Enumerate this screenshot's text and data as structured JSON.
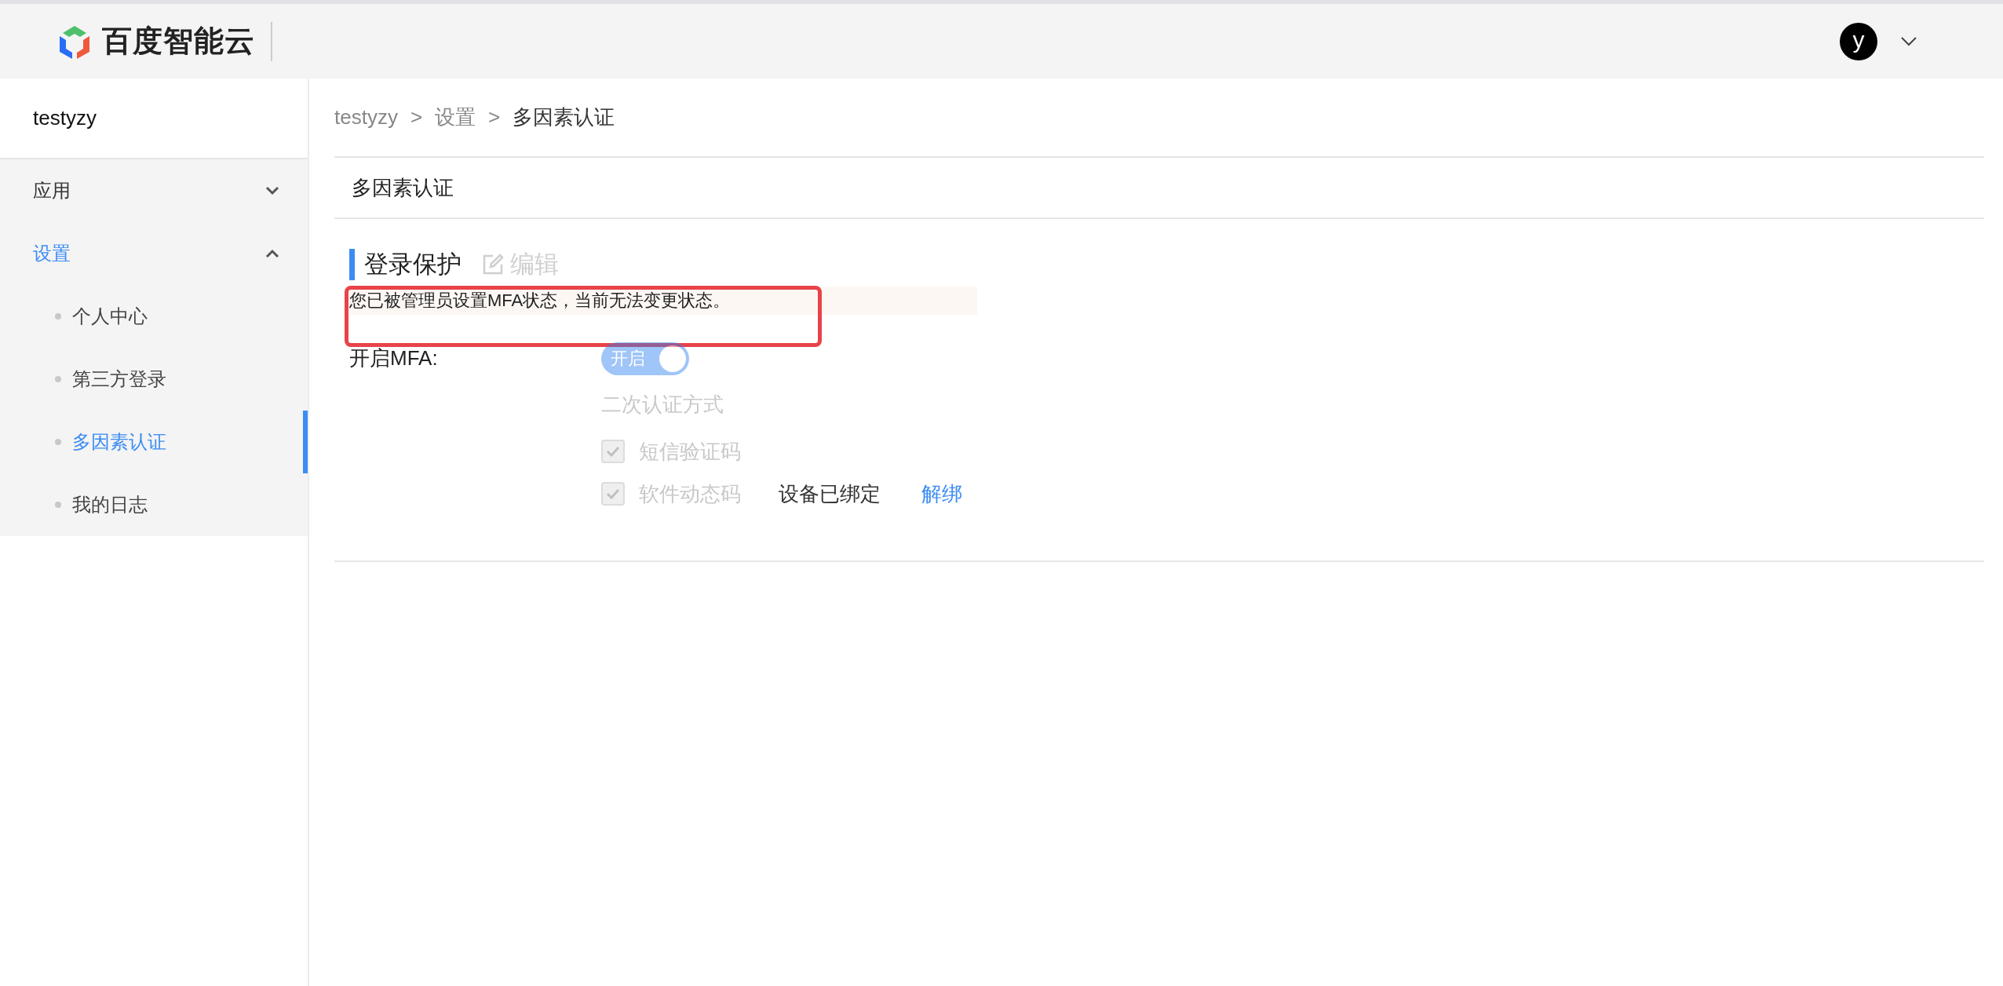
{
  "header": {
    "logo_text": "百度智能云",
    "avatar_letter": "y"
  },
  "sidebar": {
    "title": "testyzy",
    "items": [
      {
        "label": "应用",
        "expanded": false,
        "selected": false
      },
      {
        "label": "设置",
        "expanded": true,
        "selected": true,
        "children": [
          {
            "label": "个人中心",
            "selected": false
          },
          {
            "label": "第三方登录",
            "selected": false
          },
          {
            "label": "多因素认证",
            "selected": true
          },
          {
            "label": "我的日志",
            "selected": false
          }
        ]
      }
    ]
  },
  "breadcrumb": {
    "separator": ">",
    "items": [
      "testyzy",
      "设置",
      "多因素认证"
    ]
  },
  "page_title": "多因素认证",
  "section": {
    "title": "登录保护",
    "edit_label": "编辑",
    "edit_disabled": true,
    "notice": "您已被管理员设置MFA状态，当前无法变更状态。",
    "notice_highlighted": true
  },
  "mfa": {
    "label": "开启MFA:",
    "toggle": {
      "text": "开启",
      "on": true,
      "disabled": true
    },
    "methods_label": "二次认证方式",
    "methods": [
      {
        "label": "短信验证码",
        "checked": true,
        "disabled": true
      },
      {
        "label": "软件动态码",
        "checked": true,
        "disabled": true,
        "status": "设备已绑定",
        "action": "解绑"
      }
    ]
  }
}
